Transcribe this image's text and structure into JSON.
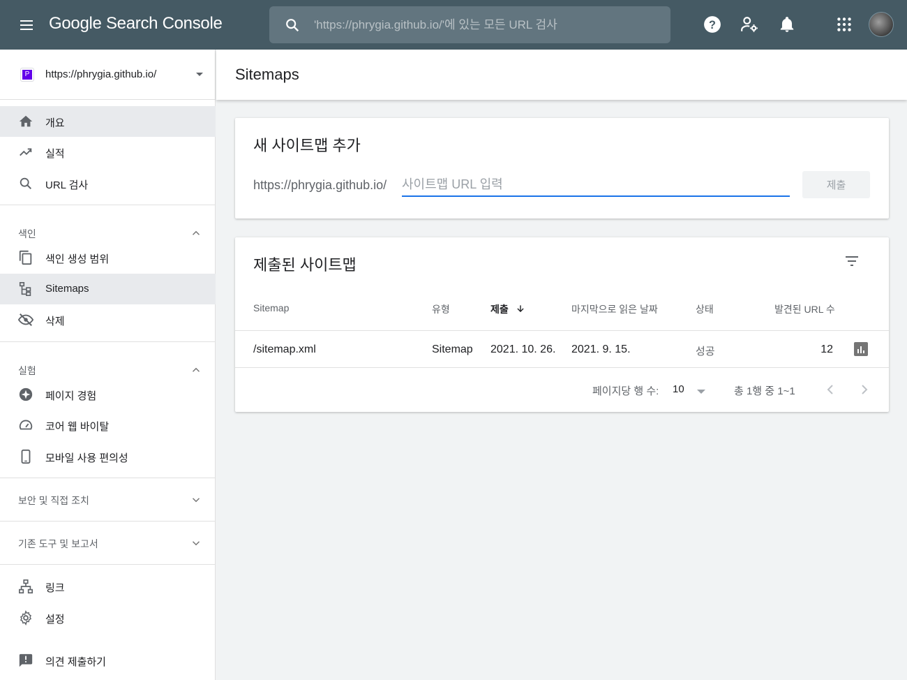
{
  "app": {
    "title": "Google Search Console"
  },
  "search": {
    "placeholder": "'https://phrygia.github.io/'에 있는 모든 URL 검사"
  },
  "property": {
    "logo_letter": "P",
    "url": "https://phrygia.github.io/"
  },
  "sidebar": {
    "items": [
      {
        "label": "개요",
        "icon": "home-icon"
      },
      {
        "label": "실적",
        "icon": "trending-up-icon"
      },
      {
        "label": "URL 검사",
        "icon": "search-icon"
      }
    ],
    "sections": [
      {
        "label": "색인",
        "expanded": true,
        "items": [
          {
            "label": "색인 생성 범위",
            "icon": "copy-pages-icon"
          },
          {
            "label": "Sitemaps",
            "icon": "sitemap-icon"
          },
          {
            "label": "삭제",
            "icon": "eye-off-icon"
          }
        ]
      },
      {
        "label": "실험",
        "expanded": true,
        "items": [
          {
            "label": "페이지 경험",
            "icon": "plus-circle-icon"
          },
          {
            "label": "코어 웹 바이탈",
            "icon": "speedometer-icon"
          },
          {
            "label": "모바일 사용 편의성",
            "icon": "phone-icon"
          }
        ]
      },
      {
        "label": "보안 및 직접 조치",
        "expanded": false
      },
      {
        "label": "기존 도구 및 보고서",
        "expanded": false
      }
    ],
    "bottom_items": [
      {
        "label": "링크",
        "icon": "network-icon"
      },
      {
        "label": "설정",
        "icon": "gear-icon"
      },
      {
        "label": "의견 제출하기",
        "icon": "feedback-icon"
      }
    ]
  },
  "page": {
    "title": "Sitemaps"
  },
  "add_sitemap": {
    "title": "새 사이트맵 추가",
    "prefix": "https://phrygia.github.io/",
    "placeholder": "사이트맵 URL 입력",
    "submit_label": "제출"
  },
  "submitted": {
    "title": "제출된 사이트맵",
    "columns": [
      "Sitemap",
      "유형",
      "제출",
      "마지막으로 읽은 날짜",
      "상태",
      "발견된 URL 수"
    ],
    "sort_column": "제출",
    "rows": [
      {
        "sitemap": "/sitemap.xml",
        "type": "Sitemap",
        "submitted": "2021. 10. 26.",
        "last_read": "2021. 9. 15.",
        "status": "성공",
        "urls": "12"
      }
    ],
    "pagination": {
      "rows_per_page_label": "페이지당 행 수:",
      "rows_per_page": "10",
      "range": "총 1행 중 1~1"
    }
  },
  "colors": {
    "topbar": "#455a64",
    "search_bg": "#62757f",
    "accent": "#1a73e8",
    "property_logo": "#6200ea"
  }
}
